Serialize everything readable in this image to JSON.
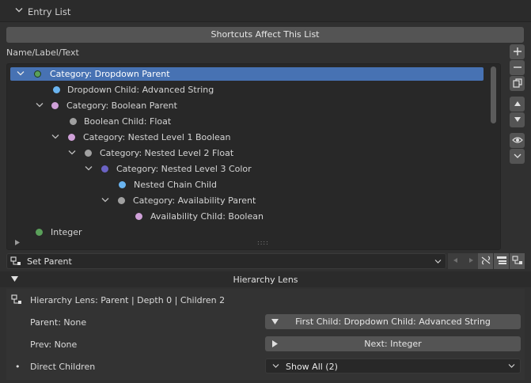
{
  "panel": {
    "title": "Entry List"
  },
  "shortcuts_button": "Shortcuts Affect This List",
  "column_header": "Name/Label/Text",
  "tree": {
    "rows": [
      {
        "label": "Category: Dropdown Parent",
        "color": "#5aa05a",
        "selected": true
      },
      {
        "label": "Dropdown Child: Advanced String",
        "color": "#6ab4f0"
      },
      {
        "label": "Category: Boolean Parent",
        "color": "#cfa0d8"
      },
      {
        "label": "Boolean Child: Float",
        "color": "#a0a0a0"
      },
      {
        "label": "Category: Nested Level 1 Boolean",
        "color": "#cfa0d8"
      },
      {
        "label": "Category: Nested Level 2 Float",
        "color": "#a0a0a0"
      },
      {
        "label": "Category: Nested Level 3 Color",
        "color": "#6b63c4"
      },
      {
        "label": "Nested Chain Child",
        "color": "#6ab4f0"
      },
      {
        "label": "Category: Availability Parent",
        "color": "#a0a0a0"
      },
      {
        "label": "Availability Child: Boolean",
        "color": "#cfa0d8"
      },
      {
        "label": "Integer",
        "color": "#5aa05a"
      }
    ],
    "grip": "::::"
  },
  "set_parent": {
    "label": "Set Parent"
  },
  "lens": {
    "title": "Hierarchy Lens",
    "summary": "Hierarchy Lens: Parent | Depth 0 | Children 2",
    "parent_label": "Parent: None",
    "first_child_button": "First Child: Dropdown Child: Advanced String",
    "prev_label": "Prev: None",
    "next_button": "Next: Integer",
    "children_label": "Direct Children",
    "children_bullet": "•",
    "children_dropdown": "Show All (2)"
  }
}
